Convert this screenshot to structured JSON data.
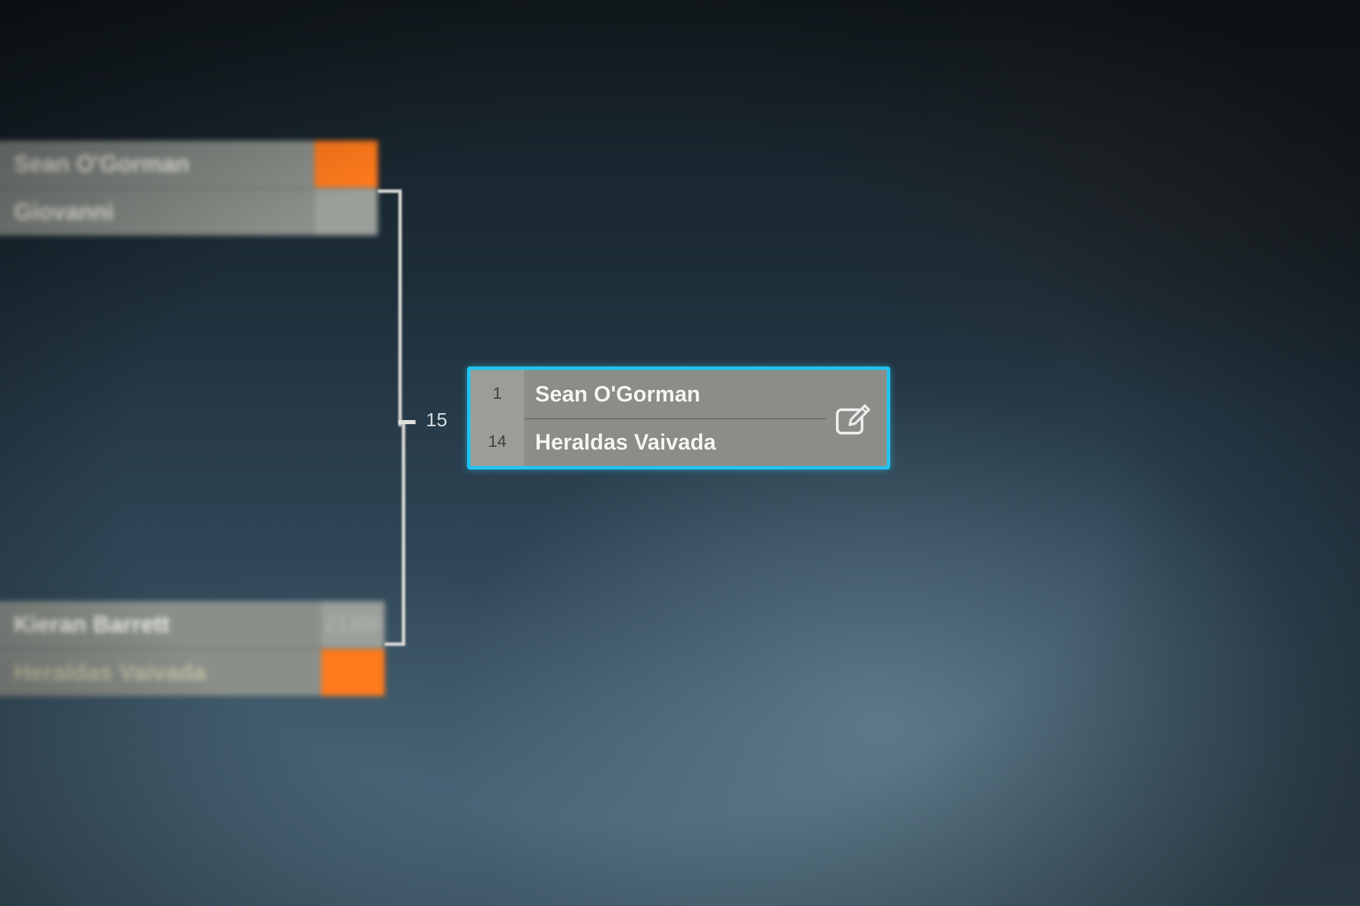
{
  "previous_round": {
    "top_match": {
      "player1": {
        "name": "Sean O'Gorman",
        "score": ""
      },
      "player2": {
        "name": "Giovanni",
        "score": ""
      }
    },
    "bottom_match": {
      "player1": {
        "name": "Kieran Barrett",
        "score": "21300"
      },
      "player2": {
        "name": "Heraldas Vaivada",
        "score": ""
      }
    }
  },
  "current_match": {
    "match_number": "15",
    "player1": {
      "seed": "1",
      "name": "Sean O'Gorman"
    },
    "player2": {
      "seed": "14",
      "name": "Heraldas Vaivada"
    },
    "edit_icon": "edit-icon"
  },
  "colors": {
    "accent": "#22c3f0",
    "winner": "#ff7a1c",
    "slot": "#8a8f8a"
  }
}
